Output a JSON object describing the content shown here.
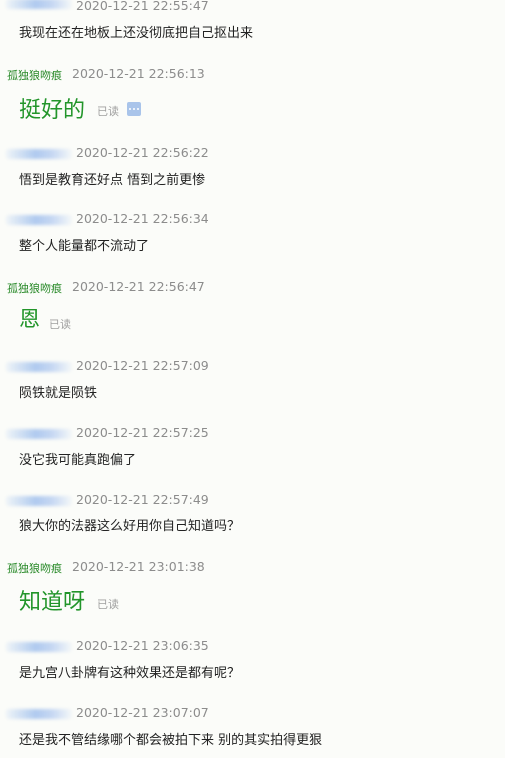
{
  "messages": [
    {
      "sender": "",
      "time": "2020-12-21 22:55:47",
      "text": "我现在还在地板上还没彻底把自己抠出来"
    },
    {
      "sender": "孤独狼吻痕",
      "time": "2020-12-21 22:56:13",
      "text": "挺好的",
      "read": "已读"
    },
    {
      "sender": "",
      "time": "2020-12-21 22:56:22",
      "text": "悟到是教育还好点 悟到之前更惨"
    },
    {
      "sender": "",
      "time": "2020-12-21 22:56:34",
      "text": "整个人能量都不流动了"
    },
    {
      "sender": "孤独狼吻痕",
      "time": "2020-12-21 22:56:47",
      "text": "恩",
      "read": "已读"
    },
    {
      "sender": "",
      "time": "2020-12-21 22:57:09",
      "text": "陨铁就是陨铁"
    },
    {
      "sender": "",
      "time": "2020-12-21 22:57:25",
      "text": "没它我可能真跑偏了"
    },
    {
      "sender": "",
      "time": "2020-12-21 22:57:49",
      "text": "狼大你的法器这么好用你自己知道吗？"
    },
    {
      "sender": "孤独狼吻痕",
      "time": "2020-12-21 23:01:38",
      "text": "知道呀",
      "read": "已读"
    },
    {
      "sender": "",
      "time": "2020-12-21 23:06:35",
      "text": "是九宫八卦牌有这种效果还是都有呢？"
    },
    {
      "sender": "",
      "time": "2020-12-21 23:07:07",
      "text": "还是我不管结缘哪个都会被拍下来 别的其实拍得更狠"
    }
  ],
  "colors": {
    "my_name": "#2a8a2a",
    "my_text": "#22952a",
    "timestamp": "#8c8c8c",
    "read_status": "#a0a0a0"
  },
  "icons": {
    "more": "more-options-icon"
  }
}
